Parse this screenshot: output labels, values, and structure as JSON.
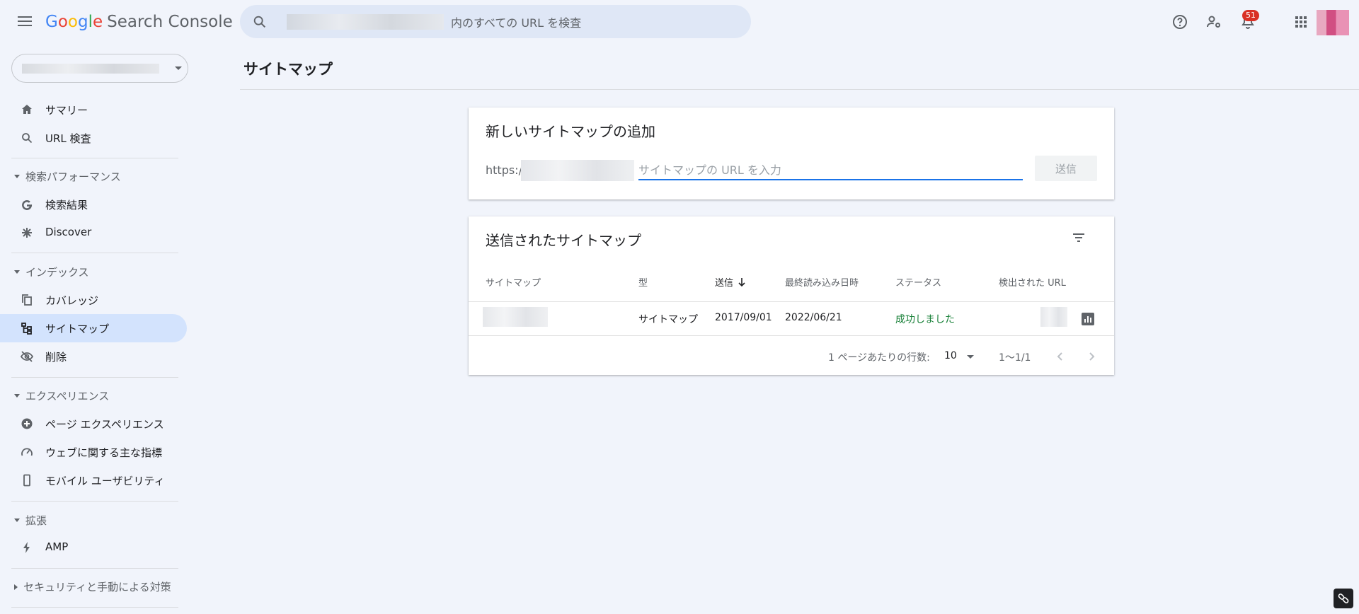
{
  "header": {
    "product_name": "Search Console",
    "search_placeholder": "内のすべての URL を検査",
    "notification_count": "51",
    "icons": [
      "menu-icon",
      "search-icon",
      "help-icon",
      "manage-users-icon",
      "notifications-icon",
      "apps-icon"
    ]
  },
  "sidebar": {
    "items_top": [
      {
        "label": "サマリー",
        "icon": "home-icon"
      },
      {
        "label": "URL 検査",
        "icon": "search-icon"
      }
    ],
    "sections": [
      {
        "label": "検索パフォーマンス",
        "items": [
          {
            "label": "検索結果",
            "icon": "google-g-icon"
          },
          {
            "label": "Discover",
            "icon": "asterisk-icon"
          }
        ]
      },
      {
        "label": "インデックス",
        "items": [
          {
            "label": "カバレッジ",
            "icon": "copy-icon"
          },
          {
            "label": "サイトマップ",
            "icon": "sitemap-icon",
            "active": true
          },
          {
            "label": "削除",
            "icon": "visibility-off-icon"
          }
        ]
      },
      {
        "label": "エクスペリエンス",
        "items": [
          {
            "label": "ページ エクスペリエンス",
            "icon": "add-circle-icon"
          },
          {
            "label": "ウェブに関する主な指標",
            "icon": "speed-icon"
          },
          {
            "label": "モバイル ユーザビリティ",
            "icon": "smartphone-icon"
          }
        ]
      },
      {
        "label": "拡張",
        "items": [
          {
            "label": "AMP",
            "icon": "bolt-icon"
          }
        ]
      },
      {
        "label": "セキュリティと手動による対策",
        "collapsed": true,
        "items": []
      }
    ]
  },
  "main": {
    "page_title": "サイトマップ",
    "add_card": {
      "title": "新しいサイトマップの追加",
      "url_prefix": "https:/",
      "input_placeholder": "サイトマップの URL を入力",
      "submit_label": "送信"
    },
    "submitted_card": {
      "title": "送信されたサイトマップ",
      "columns": [
        "サイトマップ",
        "型",
        "送信",
        "最終読み込み日時",
        "ステータス",
        "検出された URL"
      ],
      "sorted_column": "送信",
      "rows": [
        {
          "type": "サイトマップ",
          "submitted": "2017/09/01",
          "last_read": "2022/06/21",
          "status": "成功しました"
        }
      ],
      "pagination": {
        "rows_per_page_label": "1 ページあたりの行数:",
        "rows_per_page": "10",
        "range": "1〜1/1"
      }
    }
  },
  "colors": {
    "accent": "#1a73e8",
    "active_nav_bg": "#d3e3fd",
    "success": "#188038",
    "badge": "#d93025",
    "background": "#f1f4fb"
  }
}
